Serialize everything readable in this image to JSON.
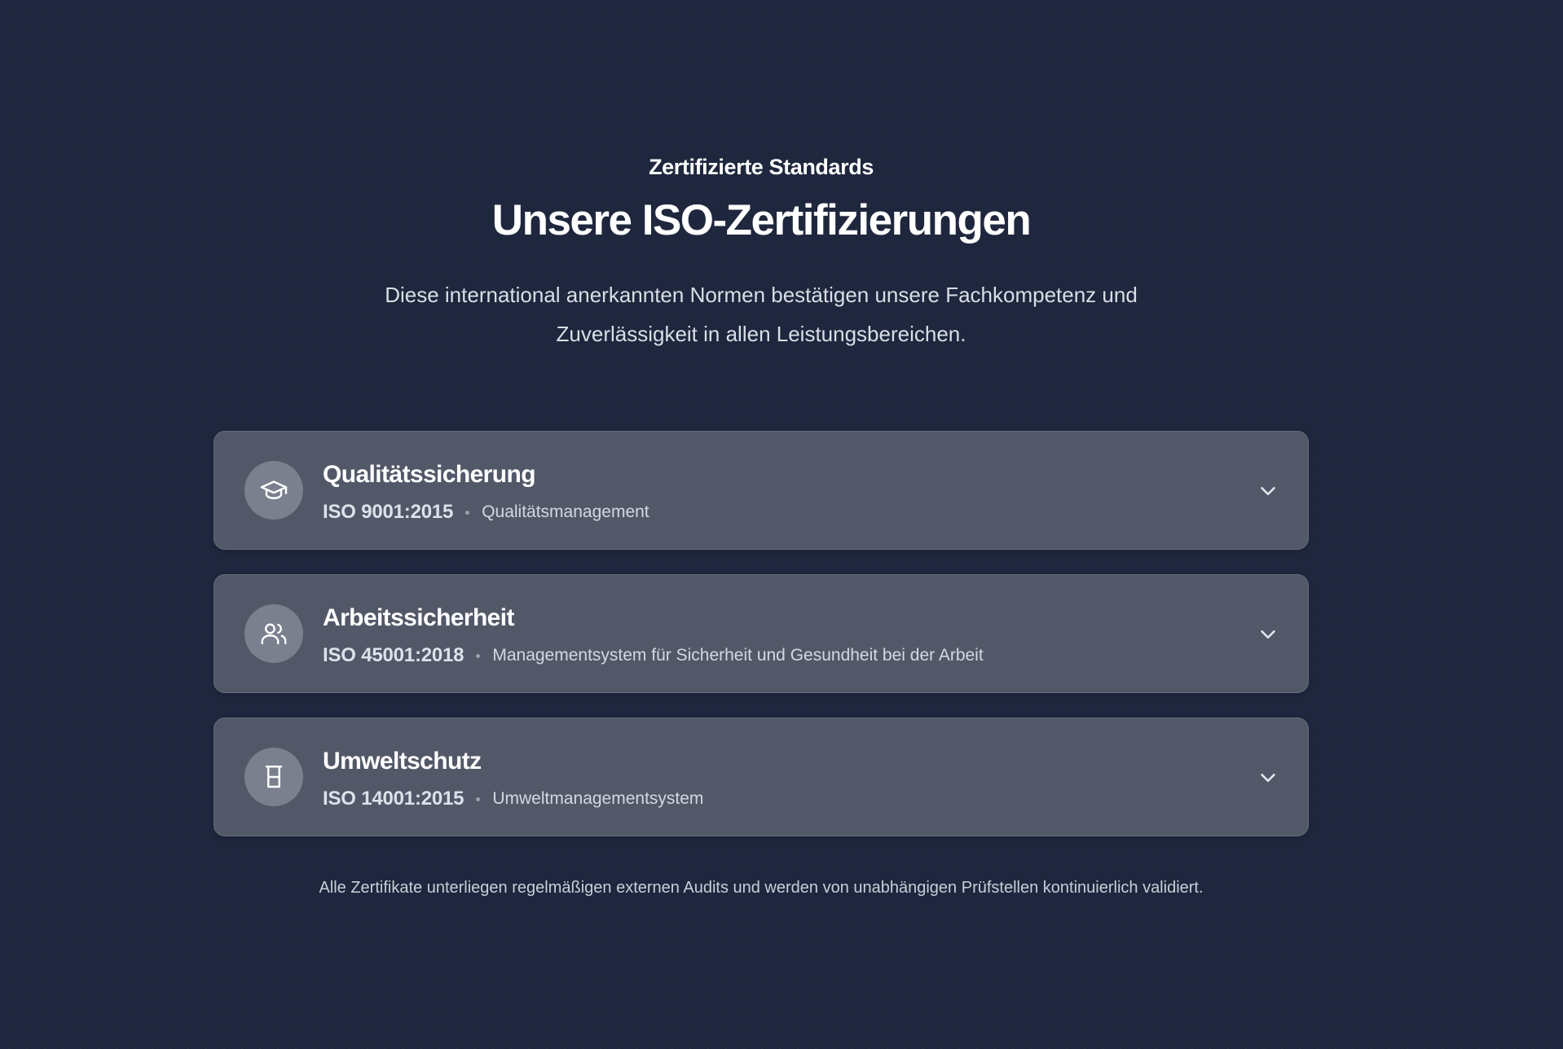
{
  "header": {
    "eyebrow": "Zertifizierte Standards",
    "title": "Unsere ISO-Zertifizierungen",
    "lead": "Diese international anerkannten Normen bestätigen unsere Fachkompetenz und Zuverlässigkeit in allen Leistungsbereichen."
  },
  "certifications": [
    {
      "title": "Qualitätssicherung",
      "code": "ISO 9001:2015",
      "description": "Qualitätsmanagement",
      "icon": "graduation-cap-icon",
      "expanded": false
    },
    {
      "title": "Arbeitssicherheit",
      "code": "ISO 45001:2018",
      "description": "Managementsystem für Sicherheit und Gesundheit bei der Arbeit",
      "icon": "users-icon",
      "expanded": false
    },
    {
      "title": "Umweltschutz",
      "code": "ISO 14001:2015",
      "description": "Umweltmanagementsystem",
      "icon": "beaker-icon",
      "expanded": false
    }
  ],
  "footnote": "Alle Zertifikate unterliegen regelmäßigen externen Audits und werden von unabhängigen Prüfstellen kontinuierlich validiert.",
  "colors": {
    "background": "#1e273d",
    "card": "#525868",
    "icon_circle": "#7a808e",
    "text": "#ffffff"
  }
}
